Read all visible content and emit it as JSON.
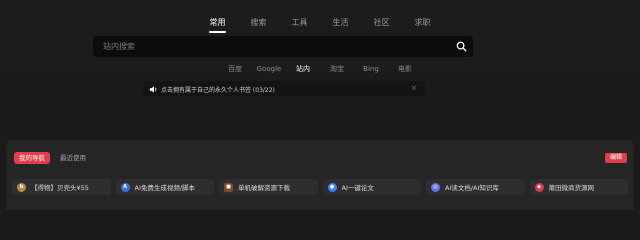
{
  "categories": [
    {
      "label": "常用",
      "active": true
    },
    {
      "label": "搜索",
      "active": false
    },
    {
      "label": "工具",
      "active": false
    },
    {
      "label": "生活",
      "active": false
    },
    {
      "label": "社区",
      "active": false
    },
    {
      "label": "求职",
      "active": false
    }
  ],
  "search": {
    "placeholder": "站内搜索",
    "value": ""
  },
  "engines": [
    {
      "label": "百度",
      "active": false
    },
    {
      "label": "Google",
      "active": false
    },
    {
      "label": "站内",
      "active": true
    },
    {
      "label": "淘宝",
      "active": false
    },
    {
      "label": "Bing",
      "active": false
    },
    {
      "label": "电影",
      "active": false
    }
  ],
  "notice": {
    "text": "点击拥有属于自己的永久个人书签 (03/22)",
    "close": "×"
  },
  "nav_panel": {
    "tabs": [
      {
        "label": "我的导航",
        "active": true
      },
      {
        "label": "最近使用",
        "active": false
      }
    ],
    "edit_label": "编辑",
    "links": [
      {
        "label": "【得物】贝壳头¥55",
        "icon": "b",
        "color": "#b08a4a"
      },
      {
        "label": "AI免费生成视频/脚本",
        "icon": "A",
        "color": "#3c6fd8"
      },
      {
        "label": "单机破解资源下载",
        "icon": "■",
        "color": "#7a4a2a"
      },
      {
        "label": "AI一键论文",
        "icon": "●",
        "color": "#3b82f6"
      },
      {
        "label": "AI读文档/AI知识库",
        "icon": "◎",
        "color": "#6d6fe0"
      },
      {
        "label": "莆田微商货源网",
        "icon": "◆",
        "color": "#d8384a"
      }
    ]
  },
  "colors": {
    "accent": "#e03e4c",
    "background": "#1b1b1b",
    "panel": "#252525"
  }
}
